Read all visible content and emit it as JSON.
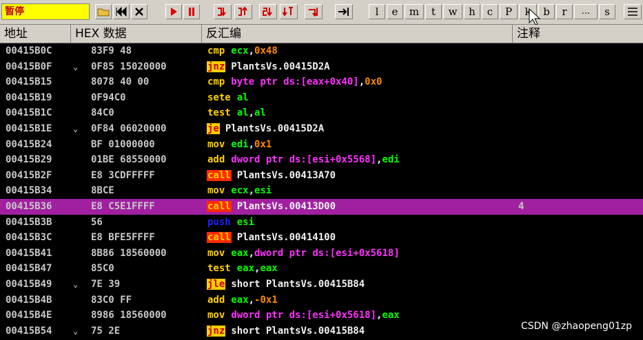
{
  "toolbar": {
    "status_label": "暂停",
    "letter_buttons": [
      "l",
      "e",
      "m",
      "t",
      "w",
      "h",
      "c",
      "P",
      "k",
      "b",
      "r",
      "...",
      "s"
    ]
  },
  "columns": {
    "address": "地址",
    "hex": "HEX 数据",
    "disasm": "反汇编",
    "comment": "注释"
  },
  "rows": [
    {
      "address": "00415B0C",
      "jump": "",
      "hex": "83F9 48",
      "mnemonic": "cmp",
      "mstyle": "plain",
      "ops": [
        {
          "t": "ecx",
          "c": "reg"
        },
        {
          "t": ",",
          "c": "op-plain"
        },
        {
          "t": "0x48",
          "c": "num"
        }
      ],
      "comment": ""
    },
    {
      "address": "00415B0F",
      "jump": "⌄",
      "hex": "0F85 15020000",
      "mnemonic": "jnz",
      "mstyle": "jmp",
      "ops": [
        {
          "t": "PlantsVs.00415D2A",
          "c": "op-plain"
        }
      ],
      "comment": ""
    },
    {
      "address": "00415B15",
      "jump": "",
      "hex": "8078 40 00",
      "mnemonic": "cmp",
      "mstyle": "plain",
      "ops": [
        {
          "t": "byte ptr ds:[eax+0x40]",
          "c": "op"
        },
        {
          "t": ",",
          "c": "op-plain"
        },
        {
          "t": "0x0",
          "c": "num"
        }
      ],
      "comment": ""
    },
    {
      "address": "00415B19",
      "jump": "",
      "hex": "0F94C0",
      "mnemonic": "sete",
      "mstyle": "plain",
      "ops": [
        {
          "t": "al",
          "c": "reg"
        }
      ],
      "comment": ""
    },
    {
      "address": "00415B1C",
      "jump": "",
      "hex": "84C0",
      "mnemonic": "test",
      "mstyle": "plain",
      "ops": [
        {
          "t": "al",
          "c": "reg"
        },
        {
          "t": ",",
          "c": "op-plain"
        },
        {
          "t": "al",
          "c": "reg"
        }
      ],
      "comment": ""
    },
    {
      "address": "00415B1E",
      "jump": "⌄",
      "hex": "0F84 06020000",
      "mnemonic": "je",
      "mstyle": "jmp",
      "ops": [
        {
          "t": "PlantsVs.00415D2A",
          "c": "op-plain"
        }
      ],
      "comment": ""
    },
    {
      "address": "00415B24",
      "jump": "",
      "hex": "BF 01000000",
      "mnemonic": "mov",
      "mstyle": "plain",
      "ops": [
        {
          "t": "edi",
          "c": "reg"
        },
        {
          "t": ",",
          "c": "op-plain"
        },
        {
          "t": "0x1",
          "c": "num"
        }
      ],
      "comment": ""
    },
    {
      "address": "00415B29",
      "jump": "",
      "hex": "01BE 68550000",
      "mnemonic": "add",
      "mstyle": "plain",
      "ops": [
        {
          "t": "dword ptr ds:[esi+0x5568]",
          "c": "op"
        },
        {
          "t": ",",
          "c": "op-plain"
        },
        {
          "t": "edi",
          "c": "reg"
        }
      ],
      "comment": ""
    },
    {
      "address": "00415B2F",
      "jump": "",
      "hex": "E8 3CDFFFFF",
      "mnemonic": "call",
      "mstyle": "call",
      "ops": [
        {
          "t": "PlantsVs.00413A70",
          "c": "op-plain"
        }
      ],
      "comment": ""
    },
    {
      "address": "00415B34",
      "jump": "",
      "hex": "8BCE",
      "mnemonic": "mov",
      "mstyle": "plain",
      "ops": [
        {
          "t": "ecx",
          "c": "reg"
        },
        {
          "t": ",",
          "c": "op-plain"
        },
        {
          "t": "esi",
          "c": "reg"
        }
      ],
      "comment": ""
    },
    {
      "address": "00415B36",
      "jump": "",
      "hex": "E8 C5E1FFFF",
      "mnemonic": "call",
      "mstyle": "call",
      "ops": [
        {
          "t": "PlantsVs.00413D00",
          "c": "op-plain"
        }
      ],
      "comment": "4",
      "selected": true
    },
    {
      "address": "00415B3B",
      "jump": "",
      "hex": "56",
      "mnemonic": "push",
      "mstyle": "push",
      "ops": [
        {
          "t": "esi",
          "c": "reg"
        }
      ],
      "comment": ""
    },
    {
      "address": "00415B3C",
      "jump": "",
      "hex": "E8 BFE5FFFF",
      "mnemonic": "call",
      "mstyle": "call",
      "ops": [
        {
          "t": "PlantsVs.00414100",
          "c": "op-plain"
        }
      ],
      "comment": ""
    },
    {
      "address": "00415B41",
      "jump": "",
      "hex": "8B86 18560000",
      "mnemonic": "mov",
      "mstyle": "plain",
      "ops": [
        {
          "t": "eax",
          "c": "reg"
        },
        {
          "t": ",",
          "c": "op-plain"
        },
        {
          "t": "dword ptr ds:[esi+0x5618]",
          "c": "op"
        }
      ],
      "comment": ""
    },
    {
      "address": "00415B47",
      "jump": "",
      "hex": "85C0",
      "mnemonic": "test",
      "mstyle": "plain",
      "ops": [
        {
          "t": "eax",
          "c": "reg"
        },
        {
          "t": ",",
          "c": "op-plain"
        },
        {
          "t": "eax",
          "c": "reg"
        }
      ],
      "comment": ""
    },
    {
      "address": "00415B49",
      "jump": "⌄",
      "hex": "7E 39",
      "mnemonic": "jle",
      "mstyle": "jmp",
      "ops": [
        {
          "t": "short PlantsVs.00415B84",
          "c": "op-plain"
        }
      ],
      "comment": ""
    },
    {
      "address": "00415B4B",
      "jump": "",
      "hex": "83C0 FF",
      "mnemonic": "add",
      "mstyle": "plain",
      "ops": [
        {
          "t": "eax",
          "c": "reg"
        },
        {
          "t": ",",
          "c": "op-plain"
        },
        {
          "t": "-0x1",
          "c": "num"
        }
      ],
      "comment": ""
    },
    {
      "address": "00415B4E",
      "jump": "",
      "hex": "8986 18560000",
      "mnemonic": "mov",
      "mstyle": "plain",
      "ops": [
        {
          "t": "dword ptr ds:[esi+0x5618]",
          "c": "op"
        },
        {
          "t": ",",
          "c": "op-plain"
        },
        {
          "t": "eax",
          "c": "reg"
        }
      ],
      "comment": ""
    },
    {
      "address": "00415B54",
      "jump": "⌄",
      "hex": "75 2E",
      "mnemonic": "jnz",
      "mstyle": "jmp",
      "ops": [
        {
          "t": "short PlantsVs.00415B84",
          "c": "op-plain"
        }
      ],
      "comment": ""
    }
  ],
  "watermark": "CSDN @zhaopeng01zp"
}
